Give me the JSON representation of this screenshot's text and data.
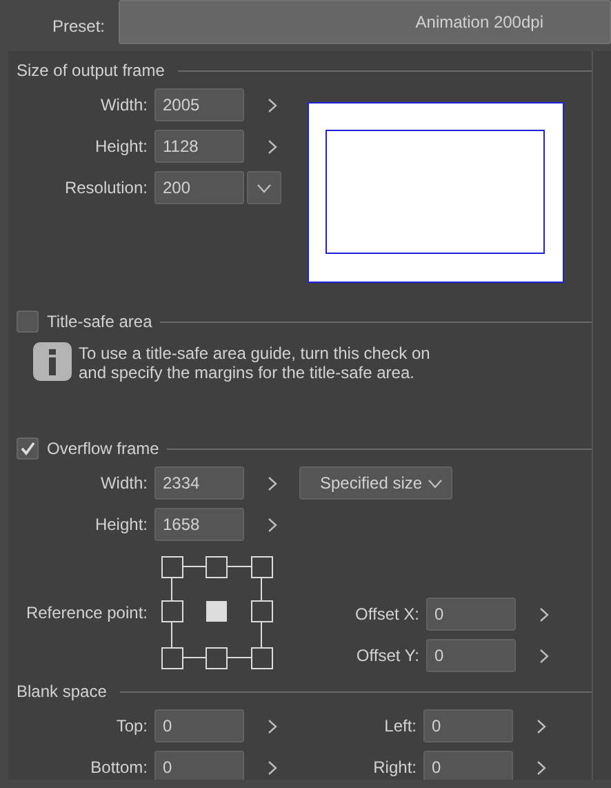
{
  "preset": {
    "label": "Preset:",
    "value": "Animation 200dpi"
  },
  "output_frame": {
    "title": "Size of output frame",
    "fields": [
      {
        "label": "Width:",
        "value": "2005",
        "kind": "stepper"
      },
      {
        "label": "Height:",
        "value": "1128",
        "kind": "stepper"
      },
      {
        "label": "Resolution:",
        "value": "200",
        "kind": "dropdown"
      }
    ]
  },
  "title_safe": {
    "label": "Title-safe area",
    "checked": false,
    "info": "To use a title-safe area guide, turn this check on and specify the margins for the title-safe area."
  },
  "overflow": {
    "label": "Overflow frame",
    "checked": true,
    "fields": [
      {
        "label": "Width:",
        "value": "2334",
        "kind": "stepper"
      },
      {
        "label": "Height:",
        "value": "1658",
        "kind": "stepper"
      }
    ],
    "size_mode": "Specified size",
    "reference_point": {
      "label": "Reference point:",
      "points": [
        {
          "selected": false
        },
        {
          "selected": false
        },
        {
          "selected": false
        },
        {
          "selected": false
        },
        {
          "selected": true
        },
        {
          "selected": false
        },
        {
          "selected": false
        },
        {
          "selected": false
        },
        {
          "selected": false
        }
      ]
    },
    "offsets": [
      {
        "label": "Offset X:",
        "value": "0",
        "kind": "stepper"
      },
      {
        "label": "Offset Y:",
        "value": "0",
        "kind": "stepper"
      }
    ]
  },
  "blank_space": {
    "title": "Blank space",
    "fields": [
      {
        "label": "Top:",
        "value": "0",
        "kind": "stepper"
      },
      {
        "label": "Left:",
        "value": "0",
        "kind": "stepper"
      },
      {
        "label": "Bottom:",
        "value": "0",
        "kind": "stepper"
      },
      {
        "label": "Right:",
        "value": "0",
        "kind": "stepper"
      }
    ]
  }
}
